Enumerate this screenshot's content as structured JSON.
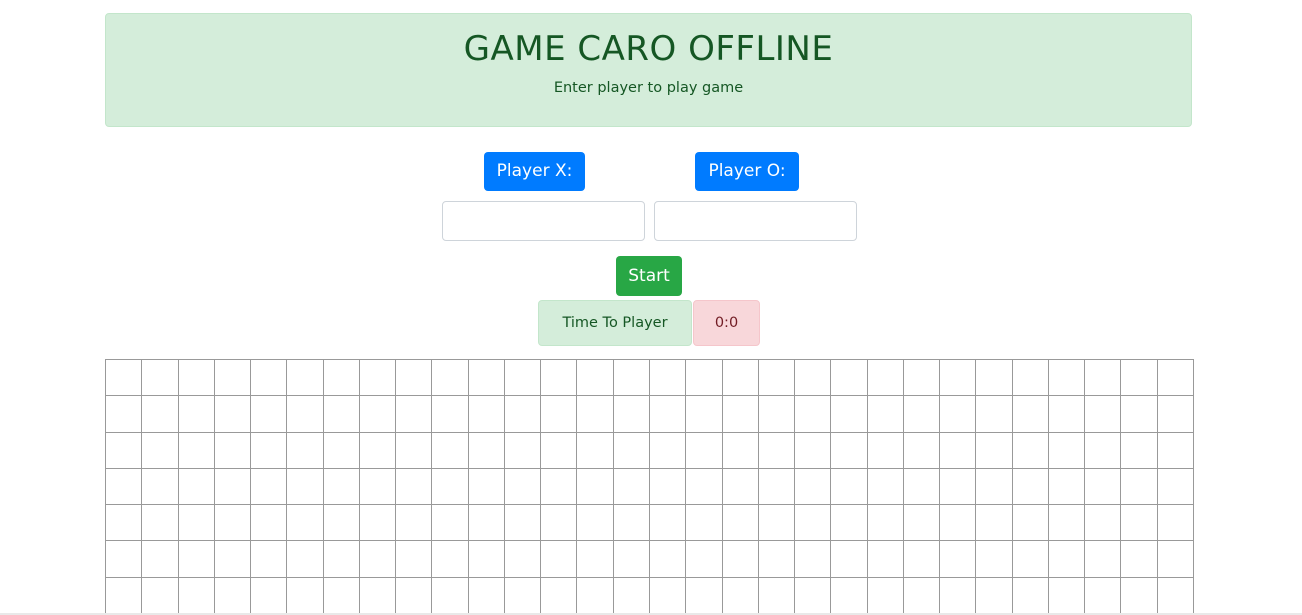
{
  "header": {
    "title": "GAME CARO OFFLINE",
    "subtitle": "Enter player to play game"
  },
  "players": {
    "x_label": "Player X:",
    "o_label": "Player O:",
    "x_value": "",
    "o_value": ""
  },
  "controls": {
    "start_label": "Start"
  },
  "timer": {
    "label": "Time To Player",
    "value": "0:0"
  },
  "board": {
    "visible_rows": 7,
    "columns": 30
  },
  "colors": {
    "primary": "#007bff",
    "success": "#28a745",
    "success_bg": "#d4edda",
    "success_text": "#155724",
    "danger_bg": "#f8d7da",
    "danger_text": "#721c24",
    "grid_line": "#999999"
  }
}
